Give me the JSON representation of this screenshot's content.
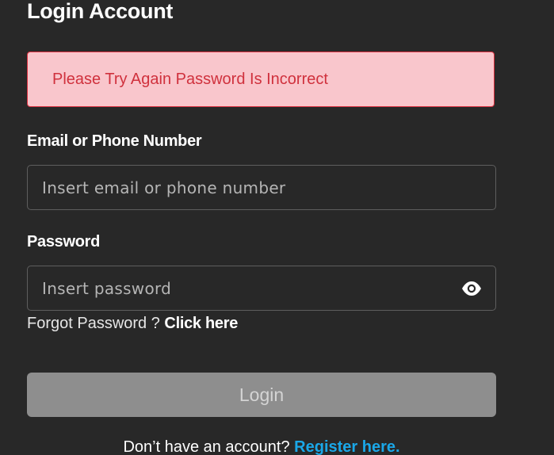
{
  "header": {
    "title": "Login Account"
  },
  "alert": {
    "message": "Please Try Again Password Is Incorrect",
    "background": "#f9c6cc",
    "text_color": "#d0313d"
  },
  "form": {
    "email": {
      "label": "Email or Phone Number",
      "value": "",
      "placeholder": "Insert email or phone number"
    },
    "password": {
      "label": "Password",
      "value": "",
      "placeholder": "Insert password",
      "toggle_icon": "eye-icon"
    },
    "forgot": {
      "prefix": "Forgot Password ? ",
      "link_label": "Click here"
    },
    "login_label": "Login"
  },
  "footer": {
    "prompt": "Don’t have an account? ",
    "link_label": "Register here.",
    "link_color": "#1aa7e8"
  }
}
